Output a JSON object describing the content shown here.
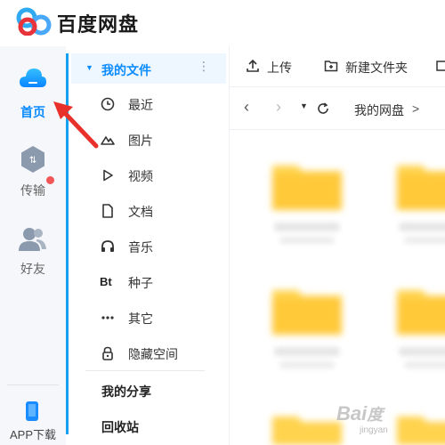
{
  "app": {
    "title": "百度网盘"
  },
  "rail": {
    "items": [
      {
        "label": "首页",
        "icon": "home-cloud-icon",
        "active": true
      },
      {
        "label": "传输",
        "icon": "transfer-icon",
        "active": false
      },
      {
        "label": "好友",
        "icon": "friends-icon",
        "active": false
      }
    ],
    "download_label": "APP下载",
    "friends_badge": true
  },
  "sidebar": {
    "my_files_label": "我的文件",
    "items": [
      {
        "label": "最近",
        "icon": "clock-icon"
      },
      {
        "label": "图片",
        "icon": "image-icon"
      },
      {
        "label": "视频",
        "icon": "video-icon"
      },
      {
        "label": "文档",
        "icon": "document-icon"
      },
      {
        "label": "音乐",
        "icon": "headphones-icon"
      },
      {
        "label": "种子",
        "icon": "bt-icon",
        "glyph": "Bt"
      },
      {
        "label": "其它",
        "icon": "more-dots-icon"
      },
      {
        "label": "隐藏空间",
        "icon": "lock-icon"
      }
    ],
    "share_label": "我的分享",
    "recycle_label": "回收站"
  },
  "toolbar": {
    "upload_label": "上传",
    "new_folder_label": "新建文件夹"
  },
  "breadcrumb": {
    "root_label": "我的网盘",
    "separator": ">"
  },
  "colors": {
    "accent": "#0a8cff",
    "accent_light": "#eef6ff",
    "folder": "#ffd34d",
    "annotation": "#e8312a"
  }
}
